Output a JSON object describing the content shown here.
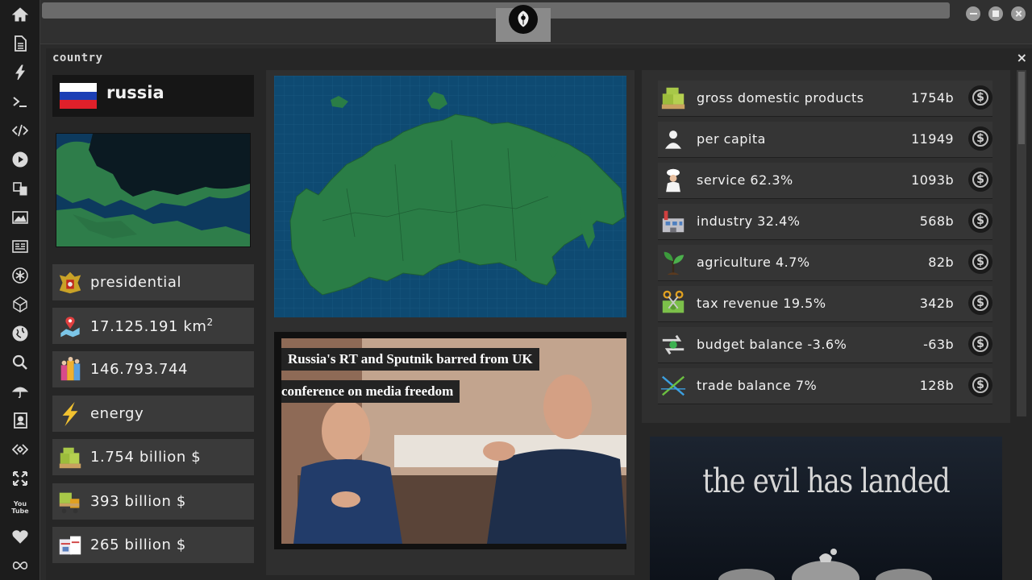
{
  "sidebar": {
    "icons": [
      "home-icon",
      "document-icon",
      "bolt-icon",
      "terminal-icon",
      "code-icon",
      "play-icon",
      "translate-icon",
      "image-icon",
      "news-icon",
      "asterisk-icon",
      "polyhedron-icon",
      "globe-icon",
      "search-icon",
      "umbrella-icon",
      "contact-icon",
      "embed-icon",
      "expand-icon",
      "youtube-icon",
      "heart-icon",
      "infinity-icon"
    ],
    "youtube_text": "You Tube"
  },
  "window": {
    "title": "country",
    "close_label": "×"
  },
  "country": {
    "name": "russia",
    "flag_colors": [
      "#ffffff",
      "#1c3fb5",
      "#e0202a"
    ],
    "stats": [
      {
        "icon": "emblem-icon",
        "text": "presidential"
      },
      {
        "icon": "map-pin-icon",
        "text": "17.125.191 km",
        "sup": "2"
      },
      {
        "icon": "population-icon",
        "text": "146.793.744"
      },
      {
        "icon": "energy-icon",
        "text": "energy"
      },
      {
        "icon": "cash-pallet-icon",
        "text": "1.754 billion $"
      },
      {
        "icon": "forklift-cash-icon",
        "text": "393 billion $"
      },
      {
        "icon": "boxes-icon",
        "text": "265 billion $"
      }
    ]
  },
  "news": {
    "headline_line1": "Russia's RT and Sputnik barred from UK",
    "headline_line2": "conference on media freedom"
  },
  "economy": {
    "rows": [
      {
        "icon": "cash-stack-icon",
        "label": "gross domestic products",
        "value": "1754b"
      },
      {
        "icon": "person-icon",
        "label": "per capita",
        "value": "11949"
      },
      {
        "icon": "chef-icon",
        "label": "service 62.3%",
        "value": "1093b"
      },
      {
        "icon": "factory-icon",
        "label": "industry 32.4%",
        "value": "568b"
      },
      {
        "icon": "sprout-icon",
        "label": "agriculture 4.7%",
        "value": "82b"
      },
      {
        "icon": "tax-scissors-icon",
        "label": "tax revenue 19.5%",
        "value": "342b"
      },
      {
        "icon": "balance-arrows-icon",
        "label": "budget balance -3.6%",
        "value": "-63b"
      },
      {
        "icon": "trade-cross-icon",
        "label": "trade balance 7%",
        "value": "128b"
      }
    ],
    "coin_symbol": "$"
  },
  "ad": {
    "title": "the evil has landed"
  }
}
